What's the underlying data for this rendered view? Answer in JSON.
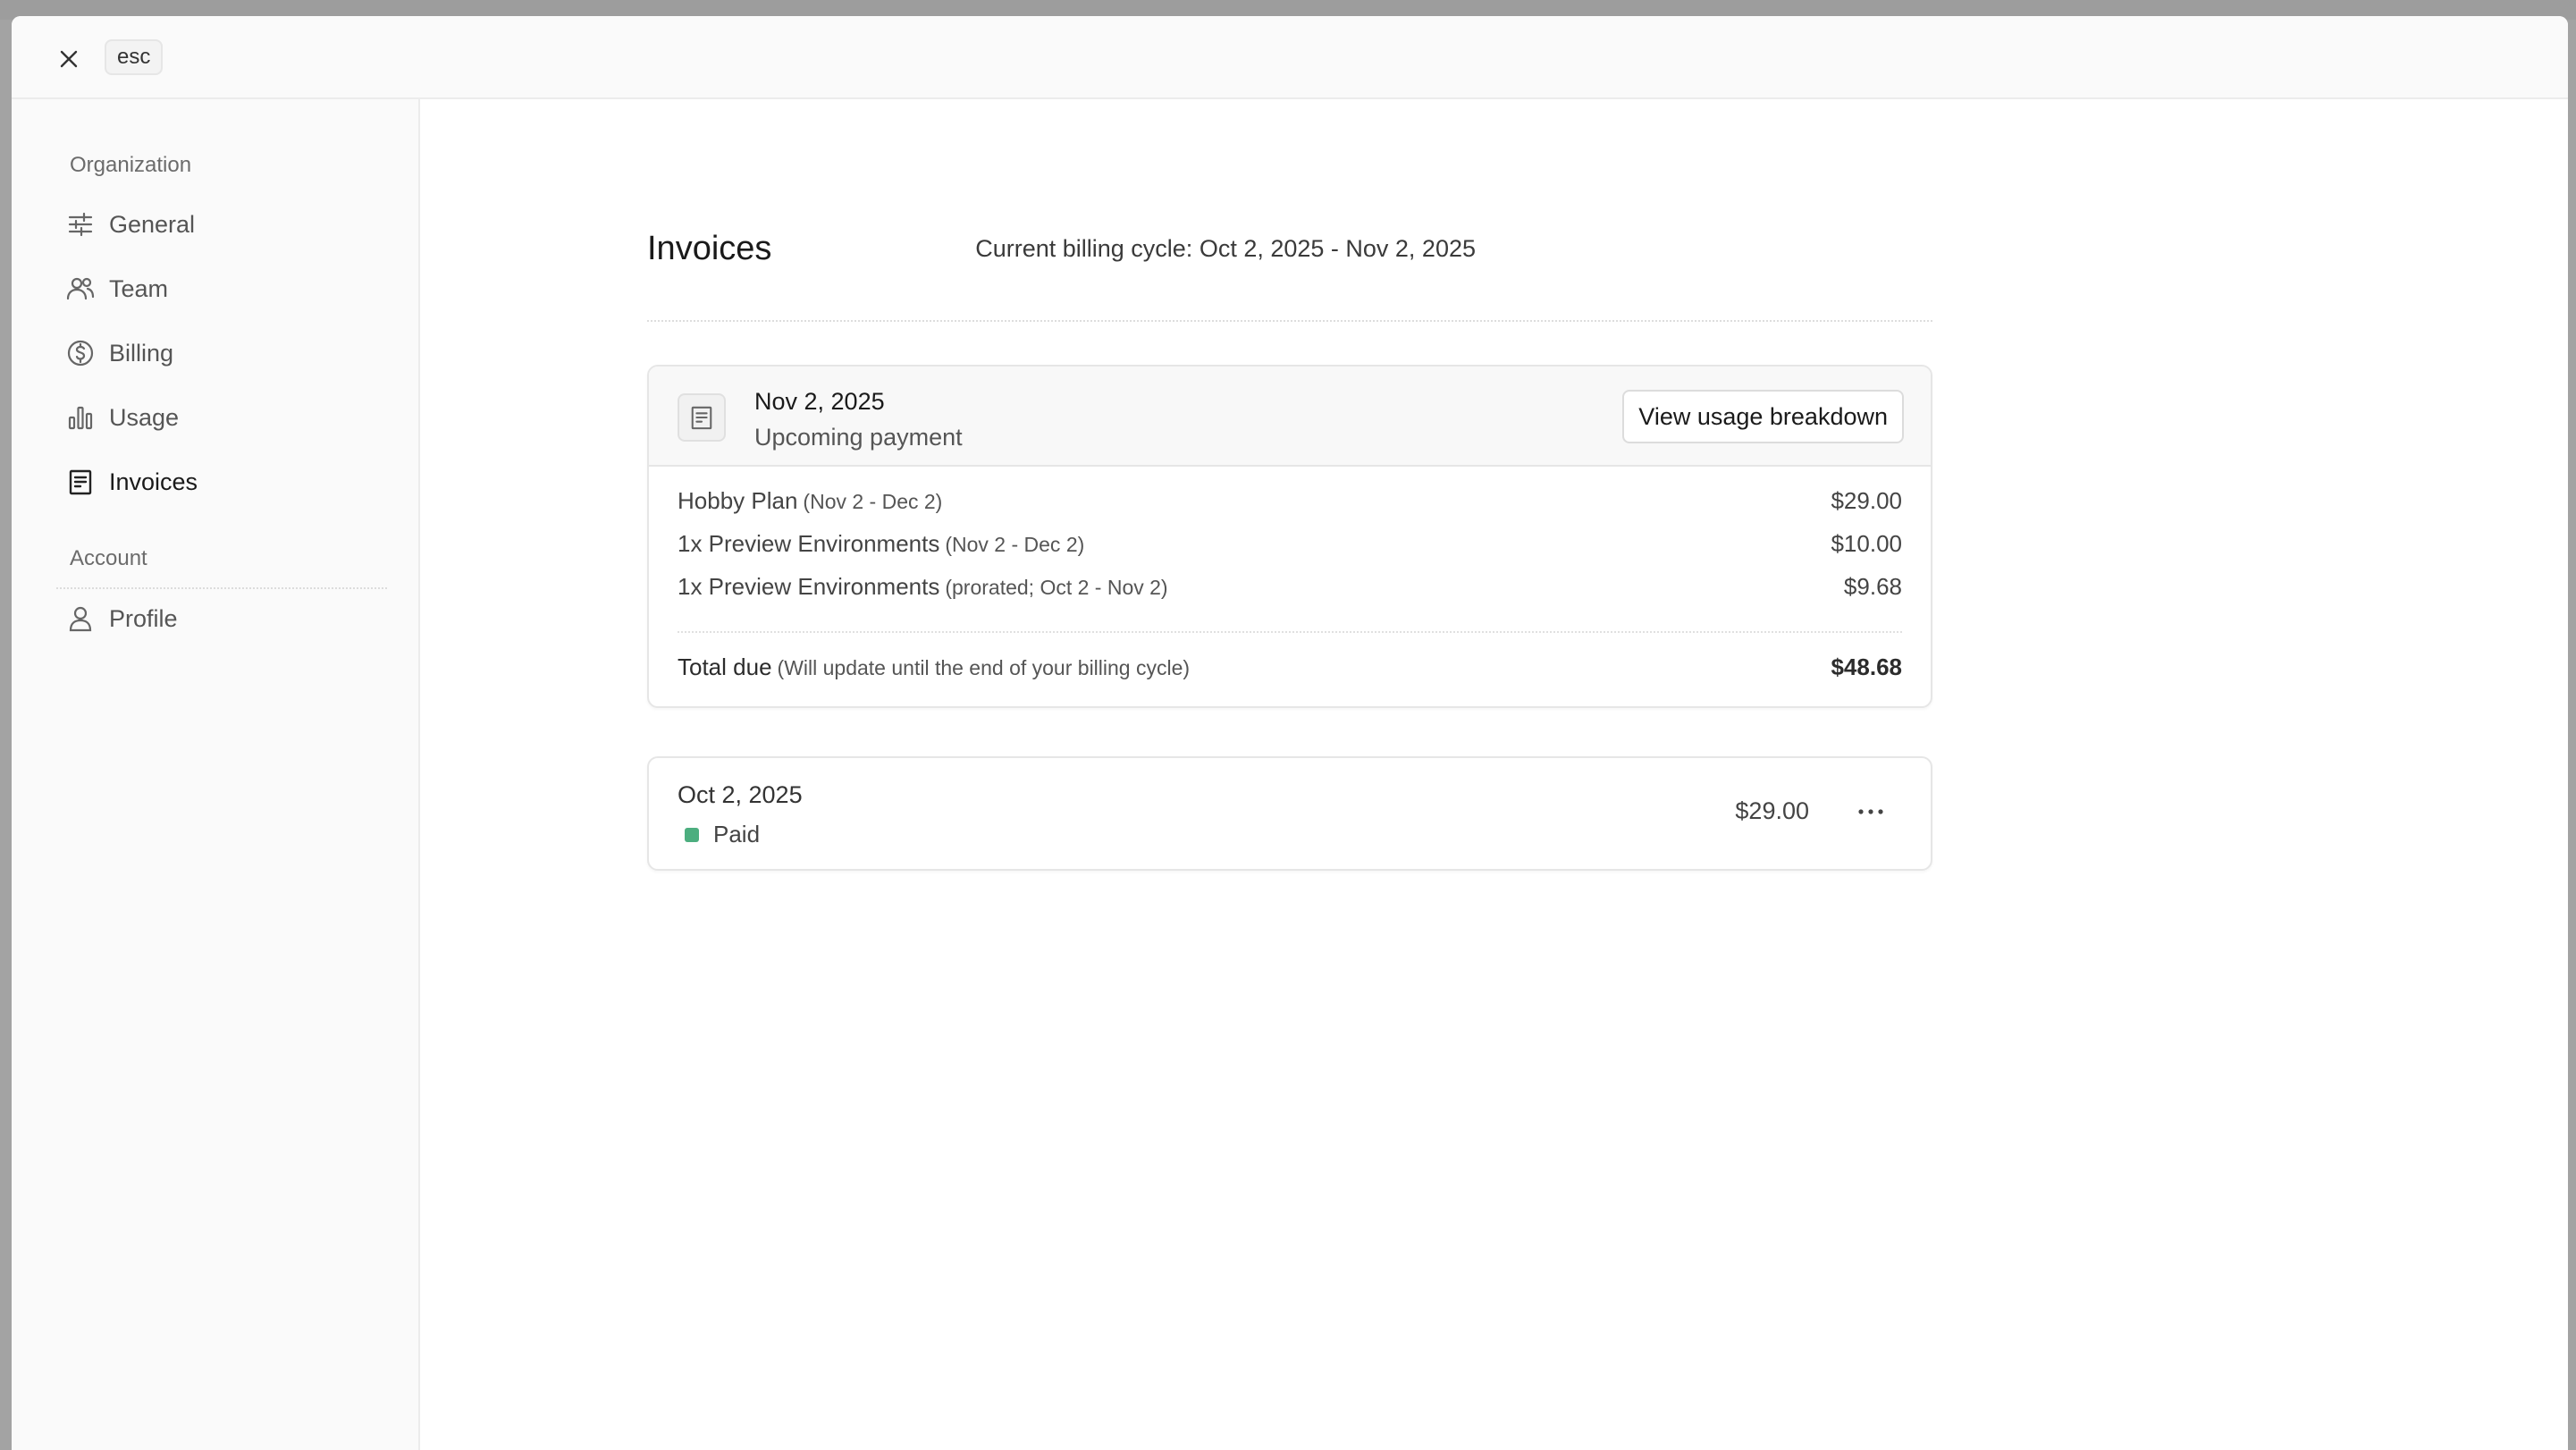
{
  "topbar": {
    "close_icon": "close-icon",
    "esc_label": "esc"
  },
  "sidebar": {
    "org_label": "Organization",
    "org_items": [
      {
        "label": "General",
        "icon": "sliders-icon"
      },
      {
        "label": "Team",
        "icon": "team-icon"
      },
      {
        "label": "Billing",
        "icon": "dollar-circle-icon"
      },
      {
        "label": "Usage",
        "icon": "bar-chart-icon"
      },
      {
        "label": "Invoices",
        "icon": "receipt-icon",
        "active": true
      }
    ],
    "account_label": "Account",
    "account_items": [
      {
        "label": "Profile",
        "icon": "user-icon"
      }
    ]
  },
  "main": {
    "title": "Invoices",
    "billing_cycle": "Current billing cycle: Oct 2, 2025 - Nov 2, 2025",
    "upcoming": {
      "date": "Nov 2, 2025",
      "subtitle": "Upcoming payment",
      "button_label": "View usage breakdown",
      "lines": [
        {
          "label": "Hobby Plan",
          "note": "(Nov 2 - Dec 2)",
          "amount": "$29.00"
        },
        {
          "label": "1x Preview Environments",
          "note": "(Nov 2 - Dec 2)",
          "amount": "$10.00"
        },
        {
          "label": "1x Preview Environments",
          "note": "(prorated; Oct 2 - Nov 2)",
          "amount": "$9.68"
        }
      ],
      "total": {
        "label": "Total due",
        "note": "(Will update until the end of your billing cycle)",
        "amount": "$48.68"
      }
    },
    "past": [
      {
        "date": "Oct 2, 2025",
        "status": "Paid",
        "status_color": "#4cae7f",
        "amount": "$29.00"
      }
    ]
  }
}
